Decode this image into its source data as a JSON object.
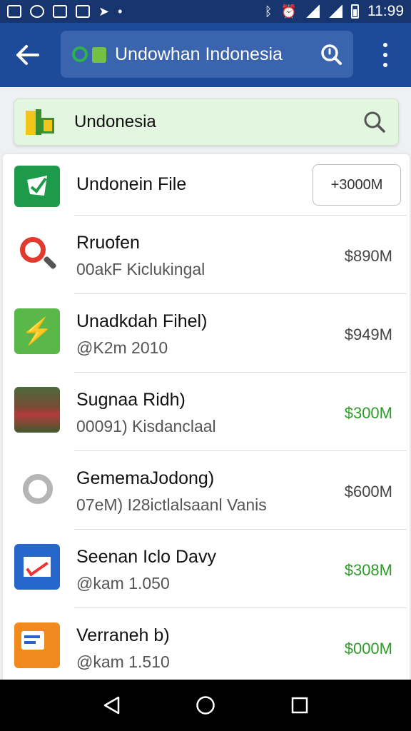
{
  "status_bar": {
    "time": "11:99"
  },
  "app_bar": {
    "search_text": "Undowhan Indonesia"
  },
  "filter": {
    "text": "Undonesia"
  },
  "list": {
    "first": {
      "title": "Undonein File",
      "price_button": "+3000M"
    },
    "items": [
      {
        "title": "Rruofen",
        "subtitle": "00akF Kiclukingal",
        "price": "$890M",
        "price_color": "#444444",
        "icon": "search-icon"
      },
      {
        "title": "Unadkdah Fihel)",
        "subtitle": "@K2m  2010",
        "price": "$949M",
        "price_color": "#444444",
        "icon": "lightning-icon"
      },
      {
        "title": "Sugnaa Ridh)",
        "subtitle": "00091) Kisdanclaal",
        "price": "$300M",
        "price_color": "#2f9a2a",
        "icon": "photo-thumbnail-icon"
      },
      {
        "title": "GememaJodong)",
        "subtitle": "07eM) I28ictlalsaanl Vanis",
        "price": "$600M",
        "price_color": "#444444",
        "icon": "ring-icon"
      },
      {
        "title": "Seenan Iclo Davy",
        "subtitle": "@kam  1.050",
        "price": "$308M",
        "price_color": "#2f9a2a",
        "icon": "mail-icon"
      },
      {
        "title": "Verraneh    b)",
        "subtitle": "@kam  1.510",
        "price": "$000M",
        "price_color": "#2f9a2a",
        "icon": "document-icon"
      }
    ]
  }
}
